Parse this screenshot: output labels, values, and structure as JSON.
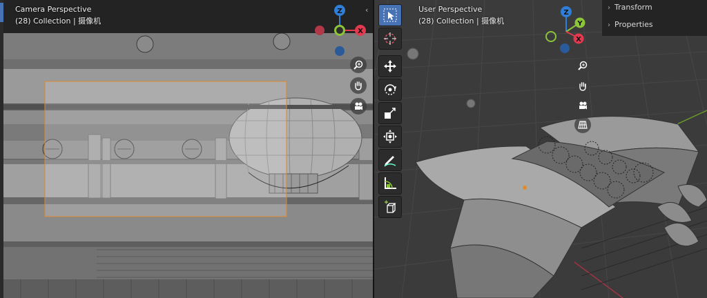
{
  "left_viewport": {
    "title": "Camera Perspective",
    "subtitle": "(28) Collection | 摄像机"
  },
  "right_viewport": {
    "title": "User Perspective",
    "subtitle": "(28) Collection | 摄像机"
  },
  "n_panel": {
    "items": [
      {
        "label": "Transform"
      },
      {
        "label": "Properties"
      }
    ]
  },
  "gizmo_left": {
    "z": "Z",
    "x": "X"
  },
  "gizmo_right": {
    "z": "Z",
    "y": "Y",
    "x": "X"
  },
  "colors": {
    "axis_x": "#e3394f",
    "axis_y": "#8cc43a",
    "axis_z": "#2f7ed8",
    "active_tool": "#4772b3",
    "camera_frame": "#e08a2c"
  },
  "toolbar_tools": [
    {
      "icon": "select-box-icon"
    },
    {
      "icon": "cursor-icon"
    },
    {
      "icon": "move-icon"
    },
    {
      "icon": "rotate-icon"
    },
    {
      "icon": "scale-icon"
    },
    {
      "icon": "transform-icon"
    },
    {
      "icon": "annotate-icon"
    },
    {
      "icon": "measure-icon"
    },
    {
      "icon": "add-cube-icon"
    }
  ],
  "nav_buttons": [
    {
      "icon": "zoom-icon"
    },
    {
      "icon": "pan-hand-icon"
    },
    {
      "icon": "camera-view-icon"
    },
    {
      "icon": "ortho-grid-icon"
    }
  ]
}
